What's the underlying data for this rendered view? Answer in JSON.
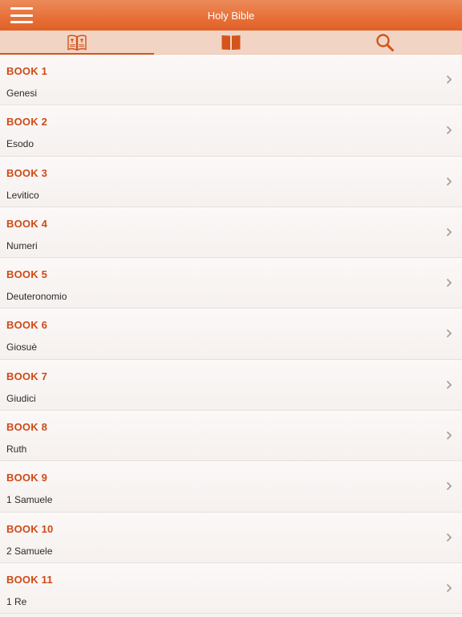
{
  "app": {
    "title": "Holy Bible"
  },
  "colors": {
    "accent": "#d4541a",
    "navbar": "#e7723a",
    "tabbar": "#f2d4c5"
  },
  "tabs": [
    {
      "icon": "open-bible-icon",
      "active": true
    },
    {
      "icon": "book-icon",
      "active": false
    },
    {
      "icon": "search-icon",
      "active": false
    }
  ],
  "books": [
    {
      "label": "BOOK 1",
      "name": "Genesi"
    },
    {
      "label": "BOOK 2",
      "name": "Esodo"
    },
    {
      "label": "BOOK 3",
      "name": "Levitico"
    },
    {
      "label": "BOOK 4",
      "name": "Numeri"
    },
    {
      "label": "BOOK 5",
      "name": "Deuteronomio"
    },
    {
      "label": "BOOK 6",
      "name": "Giosuè"
    },
    {
      "label": "BOOK 7",
      "name": "Giudici"
    },
    {
      "label": "BOOK 8",
      "name": "Ruth"
    },
    {
      "label": "BOOK 9",
      "name": "1 Samuele"
    },
    {
      "label": "BOOK 10",
      "name": "2 Samuele"
    },
    {
      "label": "BOOK 11",
      "name": "1 Re"
    }
  ]
}
